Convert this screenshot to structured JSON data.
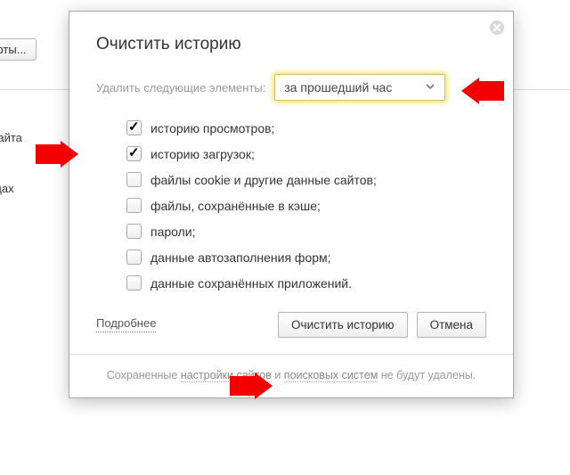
{
  "bg": {
    "button_text": "фты...",
    "link1": "и сайта",
    "link2": "ницах"
  },
  "dialog": {
    "title": "Очистить историю",
    "period_label": "Удалить следующие элементы:",
    "period_value": "за прошедший час",
    "options": [
      {
        "label": "историю просмотров;",
        "checked": true
      },
      {
        "label": "историю загрузок;",
        "checked": true
      },
      {
        "label": "файлы cookie и другие данные сайтов;",
        "checked": false
      },
      {
        "label": "файлы, сохранённые в кэше;",
        "checked": false
      },
      {
        "label": "пароли;",
        "checked": false
      },
      {
        "label": "данные автозаполнения форм;",
        "checked": false
      },
      {
        "label": "данные сохранённых приложений.",
        "checked": false
      }
    ],
    "more": "Подробнее",
    "confirm": "Очистить историю",
    "cancel": "Отмена",
    "footer": {
      "part1": "Сохраненные ",
      "link1": "настройки сайтов",
      "part2": " и ",
      "link2": "поисковых систем",
      "part3": " не будут удалены."
    }
  }
}
